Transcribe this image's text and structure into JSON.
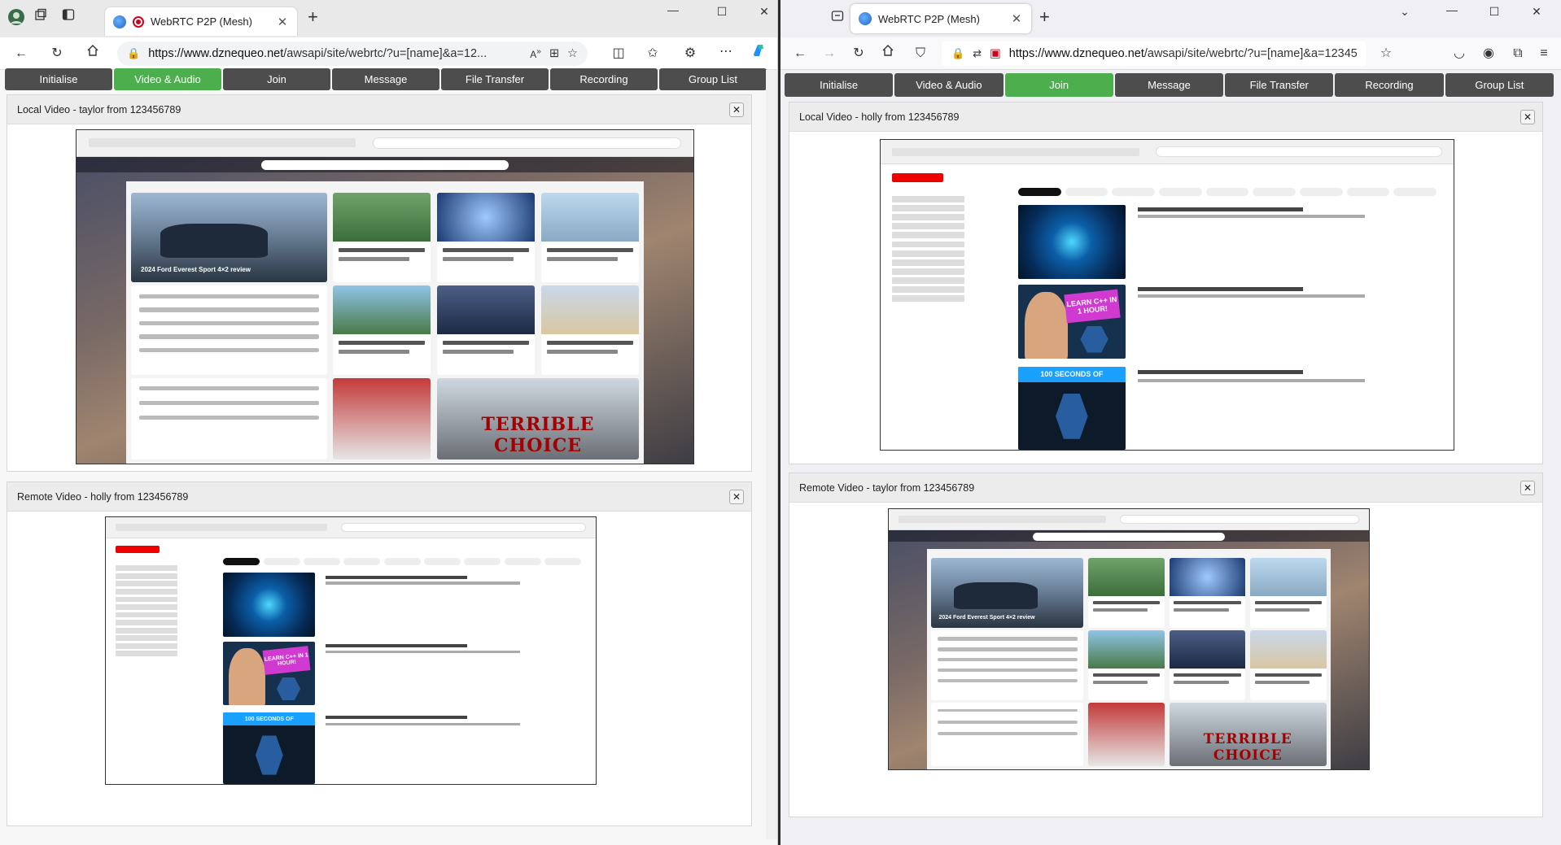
{
  "left_window": {
    "tab_title": "WebRTC P2P (Mesh)",
    "url_domain": "https://www.dznequeo.net",
    "url_path": "/awsapi/site/webrtc/?u=[name]&a=12...",
    "toolbar": [
      "Initialise",
      "Video & Audio",
      "Join",
      "Message",
      "File Transfer",
      "Recording",
      "Group List"
    ],
    "active_button": "Video & Audio",
    "local_panel_title": "Local Video - taylor from 123456789",
    "remote_panel_title": "Remote Video - holly from 123456789",
    "local_video_caption": "2024 Ford Everest Sport 4×2 review",
    "local_video_banner": "TERRIBLE CHOICE",
    "remote_video_thumb_text": "LEARN C++ IN 1 HOUR!",
    "remote_video_thumb_text2": "100 SECONDS OF"
  },
  "right_window": {
    "tab_title": "WebRTC P2P (Mesh)",
    "url_domain": "https://www.dznequeo.net",
    "url_path": "/awsapi/site/webrtc/?u=[name]&a=12345",
    "toolbar": [
      "Initialise",
      "Video & Audio",
      "Join",
      "Message",
      "File Transfer",
      "Recording",
      "Group List"
    ],
    "active_button": "Join",
    "local_panel_title": "Local Video - holly from 123456789",
    "remote_panel_title": "Remote Video - taylor from 123456789",
    "local_video_thumb_text": "LEARN C++ IN 1 HOUR!",
    "local_video_thumb_text2": "100 SECONDS OF",
    "remote_video_caption": "2024 Ford Everest Sport 4×2 review",
    "remote_video_banner": "TERRIBLE CHOICE"
  },
  "close_glyph": "✕",
  "accent": {
    "button_dark": "#4d4d4d",
    "button_active": "#4cae4c"
  }
}
